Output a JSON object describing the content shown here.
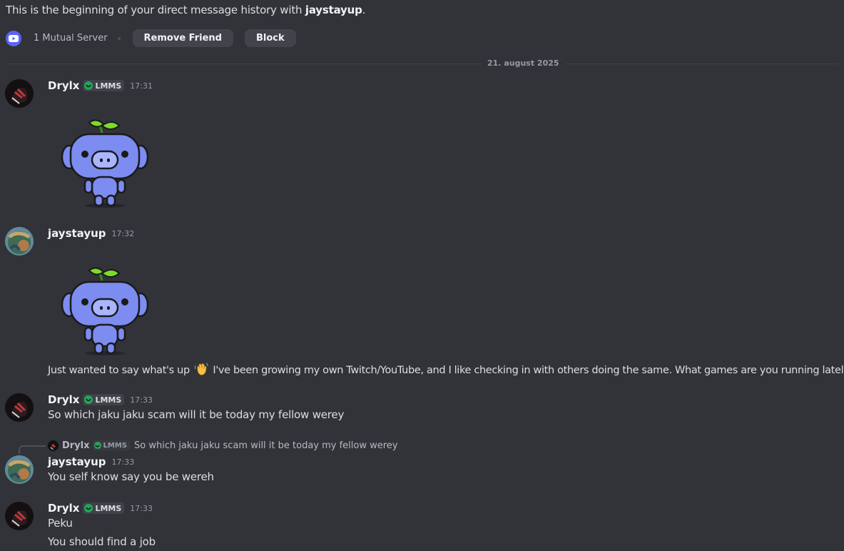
{
  "intro": {
    "prefix": "This is the beginning of your direct message history with ",
    "username": "jaystayup",
    "suffix": ".",
    "mutual_servers": "1 Mutual Server",
    "remove_friend": "Remove Friend",
    "block": "Block"
  },
  "date_divider": "21. august 2025",
  "messages": [
    {
      "author": "Drylx",
      "tag": "LMMS",
      "time": "17:31"
    },
    {
      "author": "jaystayup",
      "time": "17:32",
      "text_before": "Just wanted to say what's up",
      "text_after": "I've been growing my own Twitch/YouTube, and I like checking in with others doing the same. What games are you running lately?"
    },
    {
      "author": "Drylx",
      "tag": "LMMS",
      "time": "17:33",
      "text": "So which jaku jaku scam will it be today my fellow werey"
    },
    {
      "author": "jaystayup",
      "time": "17:33",
      "reply": {
        "author": "Drylx",
        "tag": "LMMS",
        "text": "So which jaku jaku scam will it be today my fellow werey"
      },
      "text": "You self know say you be wereh"
    },
    {
      "author": "Drylx",
      "tag": "LMMS",
      "time": "17:33",
      "lines": [
        "Peku",
        "You should find a job"
      ]
    }
  ],
  "colors": {
    "background": "#323339",
    "blurple": "#5865f2",
    "tag_green": "#23a55a",
    "sticker_body": "#7c8cf0",
    "sprout": "#7cdb2a"
  },
  "icons": {
    "server": "youtube-server-icon",
    "tag": "guild-tag-icon",
    "sticker": "wumpus-sprout-sticker",
    "wave": "waving-hand-emoji"
  }
}
